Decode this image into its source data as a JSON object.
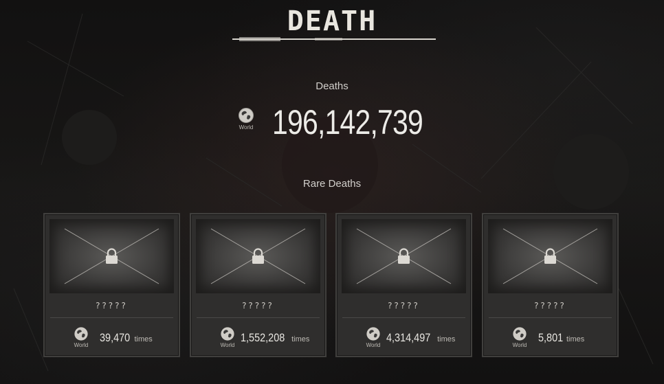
{
  "header": {
    "title": "DEATH"
  },
  "summary": {
    "deaths_label": "Deaths",
    "world_label": "World",
    "deaths_count": "196,142,739"
  },
  "rare": {
    "label": "Rare Deaths",
    "cards": [
      {
        "name": "?????",
        "world_label": "World",
        "count": "39,470",
        "unit": "times",
        "locked": true
      },
      {
        "name": "?????",
        "world_label": "World",
        "count": "1,552,208",
        "unit": "times",
        "locked": true
      },
      {
        "name": "?????",
        "world_label": "World",
        "count": "4,314,497",
        "unit": "times",
        "locked": true
      },
      {
        "name": "?????",
        "world_label": "World",
        "count": "5,801",
        "unit": "times",
        "locked": true
      }
    ]
  },
  "icons": {
    "globe": "globe-icon",
    "lock": "lock-icon"
  },
  "colors": {
    "background": "#141313",
    "card": "#2f2e2d",
    "text": "#d8d6d2"
  }
}
